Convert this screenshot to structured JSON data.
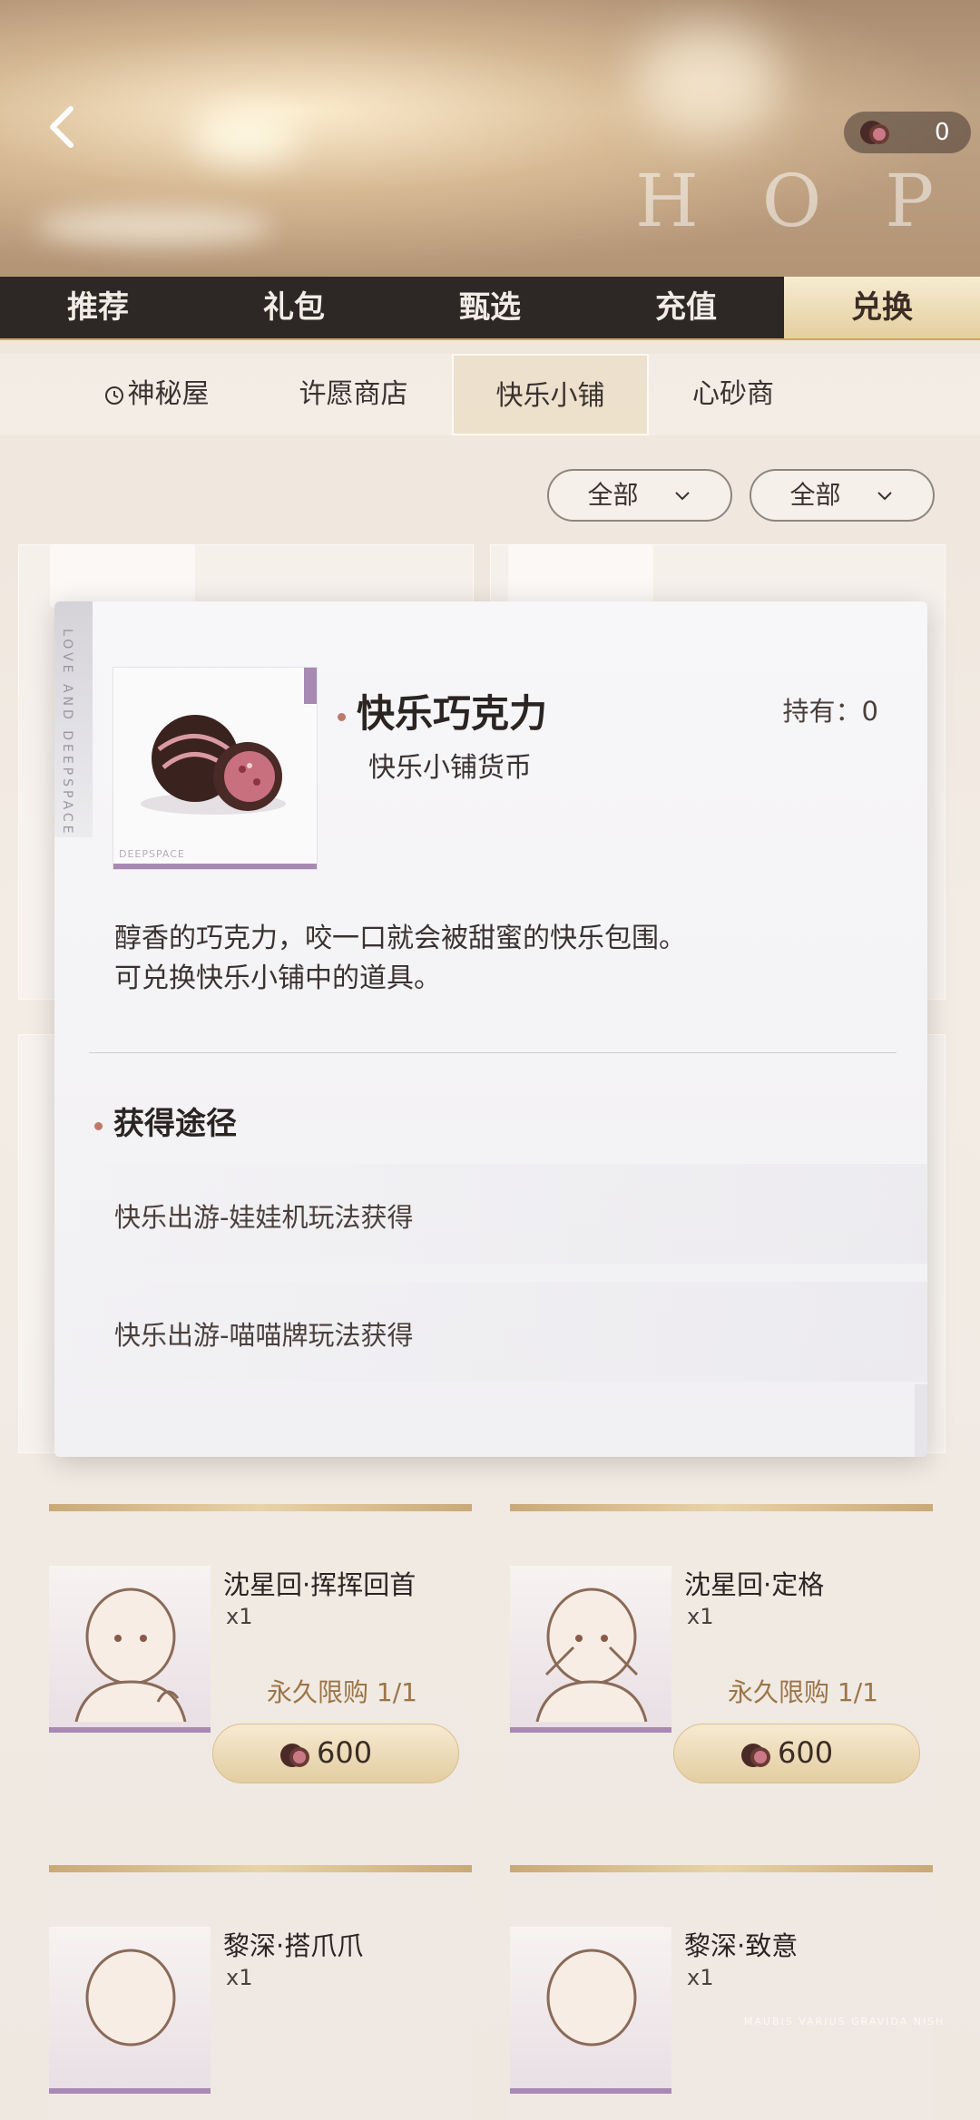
{
  "header": {
    "decor_text": "HOP",
    "currency_count": "0"
  },
  "main_tabs": [
    {
      "label": "推荐"
    },
    {
      "label": "礼包"
    },
    {
      "label": "甄选"
    },
    {
      "label": "充值"
    },
    {
      "label": "兑换"
    }
  ],
  "sub_tabs": [
    {
      "label": "神秘屋"
    },
    {
      "label": "许愿商店"
    },
    {
      "label": "快乐小铺"
    },
    {
      "label": "心砂商"
    }
  ],
  "filters": [
    {
      "label": "全部"
    },
    {
      "label": "全部"
    }
  ],
  "modal": {
    "stripe_text": "LOVE AND DEEPSPACE",
    "thumb_tag": "DEEPSPACE",
    "item_name": "快乐巧克力",
    "item_type": "快乐小铺货币",
    "owned": "持有：0",
    "description_lines": [
      "醇香的巧克力，咬一口就会被甜蜜的快乐包围。",
      "可兑换快乐小铺中的道具。"
    ],
    "source_title": "获得途径",
    "sources": [
      "快乐出游-娃娃机玩法获得",
      "快乐出游-喵喵牌玩法获得"
    ]
  },
  "cards": [
    {
      "name": "沈星回·挥挥回首",
      "qty": "x1",
      "limit": "永久限购 1/1",
      "price": "600"
    },
    {
      "name": "沈星回·定格",
      "qty": "x1",
      "limit": "永久限购 1/1",
      "price": "600"
    },
    {
      "name": "黎深·搭爪爪",
      "qty": "x1",
      "limit": "",
      "price": ""
    },
    {
      "name": "黎深·致意",
      "qty": "x1",
      "limit": "",
      "price": ""
    }
  ],
  "footer_deco": "MAUBIS VARIUS GRAVIDA NISH",
  "colors": {
    "tab_bar": "#2d2726",
    "tab_active": "#e4cf9e",
    "accent_dot": "#c0786a",
    "limit_text": "#9c7548",
    "thumb_border": "#a889b3"
  }
}
